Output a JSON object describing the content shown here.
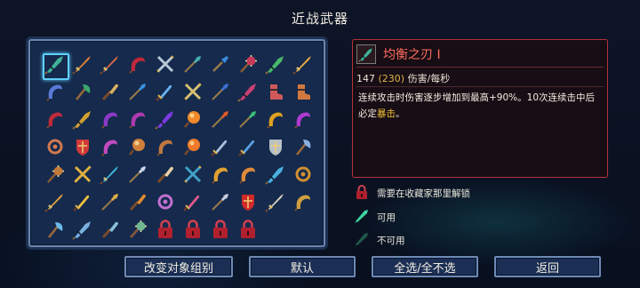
{
  "screen": {
    "title": "近战武器"
  },
  "grid": {
    "items": [
      {
        "icon": "balanced-blade-icon",
        "color": "#3fb49a",
        "shape": "blade",
        "selected": true
      },
      {
        "icon": "rusty-sword-icon",
        "color": "#e0843a",
        "shape": "sword"
      },
      {
        "icon": "broadsword-icon",
        "color": "#d86a4a",
        "shape": "sword"
      },
      {
        "icon": "whip-icon",
        "color": "#c0283a",
        "shape": "curve"
      },
      {
        "icon": "twin-daggers-icon",
        "color": "#b8c8d8",
        "shape": "cross"
      },
      {
        "icon": "spear-icon",
        "color": "#4ab0b0",
        "shape": "spear"
      },
      {
        "icon": "shovel-icon",
        "color": "#3a8ad8",
        "shape": "shovel"
      },
      {
        "icon": "spiked-club-icon",
        "color": "#c83a5a",
        "shape": "mace"
      },
      {
        "icon": "leaf-blade-icon",
        "color": "#4ab86a",
        "shape": "blade"
      },
      {
        "icon": "flame-sword-icon",
        "color": "#f0b040",
        "shape": "sword"
      },
      {
        "icon": "vine-whip-icon",
        "color": "#5a7ad8",
        "shape": "curve"
      },
      {
        "icon": "green-axe-icon",
        "color": "#3aa86a",
        "shape": "axe"
      },
      {
        "icon": "bone-club-icon",
        "color": "#d8b060",
        "shape": "club"
      },
      {
        "icon": "frost-spear-icon",
        "color": "#3a90e0",
        "shape": "spear"
      },
      {
        "icon": "ice-dagger-icon",
        "color": "#6ab0f0",
        "shape": "dagger"
      },
      {
        "icon": "crossed-blades-icon",
        "color": "#d8c070",
        "shape": "cross"
      },
      {
        "icon": "sapphire-rapier-icon",
        "color": "#3a70d0",
        "shape": "spear"
      },
      {
        "icon": "thorn-blade-icon",
        "color": "#c84070",
        "shape": "blade"
      },
      {
        "icon": "iron-boots-icon",
        "color": "#d05a5a",
        "shape": "boot"
      },
      {
        "icon": "war-boots-icon",
        "color": "#d07840",
        "shape": "boot"
      },
      {
        "icon": "blood-scythe-icon",
        "color": "#c02a3a",
        "shape": "curve"
      },
      {
        "icon": "golden-key-blade-icon",
        "color": "#d0a030",
        "shape": "blade"
      },
      {
        "icon": "violet-whip-icon",
        "color": "#8a3ac8",
        "shape": "curve"
      },
      {
        "icon": "serpent-whip-icon",
        "color": "#b03ab0",
        "shape": "curve"
      },
      {
        "icon": "shadow-blade-icon",
        "color": "#7a3ae0",
        "shape": "blade"
      },
      {
        "icon": "fire-fist-icon",
        "color": "#f08a2a",
        "shape": "orb"
      },
      {
        "icon": "pyro-staff-icon",
        "color": "#e05a2a",
        "shape": "spear"
      },
      {
        "icon": "jade-spear-icon",
        "color": "#3ac07a",
        "shape": "spear"
      },
      {
        "icon": "sun-scythe-icon",
        "color": "#e0a020",
        "shape": "curve"
      },
      {
        "icon": "curse-claw-icon",
        "color": "#b03ad0",
        "shape": "curve"
      },
      {
        "icon": "magnifier-club-icon",
        "color": "#d07850",
        "shape": "ring"
      },
      {
        "icon": "crimson-shield-icon",
        "color": "#d03a3a",
        "shape": "shield"
      },
      {
        "icon": "night-scythe-icon",
        "color": "#c04ac0",
        "shape": "curve"
      },
      {
        "icon": "lute-axe-icon",
        "color": "#d0803a",
        "shape": "orb"
      },
      {
        "icon": "hook-cane-icon",
        "color": "#c07840",
        "shape": "curve"
      },
      {
        "icon": "comet-blade-icon",
        "color": "#f07a2a",
        "shape": "orb"
      },
      {
        "icon": "steel-saber-icon",
        "color": "#a8c0d8",
        "shape": "dagger"
      },
      {
        "icon": "arc-dagger-icon",
        "color": "#5aa0e0",
        "shape": "dagger"
      },
      {
        "icon": "tome-flail-icon",
        "color": "#b8c0c8",
        "shape": "shield"
      },
      {
        "icon": "storm-axe-icon",
        "color": "#8ab0e0",
        "shape": "axe"
      },
      {
        "icon": "bronze-mace-icon",
        "color": "#c07a3a",
        "shape": "mace"
      },
      {
        "icon": "gold-crossguard-icon",
        "color": "#e0b040",
        "shape": "cross"
      },
      {
        "icon": "aqua-sword-icon",
        "color": "#40b8e0",
        "shape": "sword"
      },
      {
        "icon": "pearl-lance-icon",
        "color": "#d0d8e8",
        "shape": "spear"
      },
      {
        "icon": "bone-hammer-icon",
        "color": "#e8d0a8",
        "shape": "club"
      },
      {
        "icon": "cyan-trident-icon",
        "color": "#40a0c8",
        "shape": "cross"
      },
      {
        "icon": "golden-hook-icon",
        "color": "#e0a030",
        "shape": "curve"
      },
      {
        "icon": "ember-whip-icon",
        "color": "#e08a3a",
        "shape": "curve"
      },
      {
        "icon": "wave-scythe-icon",
        "color": "#4ab0e0",
        "shape": "blade"
      },
      {
        "icon": "spiked-ball-icon",
        "color": "#d09030",
        "shape": "ring"
      },
      {
        "icon": "amber-sword-icon",
        "color": "#e0a040",
        "shape": "sword"
      },
      {
        "icon": "torch-blade-icon",
        "color": "#f0c040",
        "shape": "dagger"
      },
      {
        "icon": "golden-scepter-icon",
        "color": "#e0b040",
        "shape": "spear"
      },
      {
        "icon": "war-club-icon",
        "color": "#e08a30",
        "shape": "club"
      },
      {
        "icon": "crystal-ring-icon",
        "color": "#c070d0",
        "shape": "ring"
      },
      {
        "icon": "rose-dagger-icon",
        "color": "#e05a8a",
        "shape": "dagger"
      },
      {
        "icon": "silver-rapier-icon",
        "color": "#c8d0e0",
        "shape": "spear"
      },
      {
        "icon": "royal-chest-blade-icon",
        "color": "#d02a2a",
        "shape": "shield"
      },
      {
        "icon": "bone-saber-icon",
        "color": "#d8d0c0",
        "shape": "sword"
      },
      {
        "icon": "chain-sickle-icon",
        "color": "#d0a040",
        "shape": "curve"
      },
      {
        "icon": "frost-axe-icon",
        "color": "#6ab8e8",
        "shape": "axe"
      },
      {
        "icon": "glacier-blade-icon",
        "color": "#7ab0e0",
        "shape": "blade"
      },
      {
        "icon": "spring-coil-icon",
        "color": "#8ac0d8",
        "shape": "club"
      },
      {
        "icon": "jade-hammer-icon",
        "color": "#70b890",
        "shape": "mace"
      },
      {
        "icon": "locked-blueprint-icon",
        "color": "#c0283a",
        "shape": "lock"
      },
      {
        "icon": "locked-blueprint-icon",
        "color": "#c0283a",
        "shape": "lock"
      },
      {
        "icon": "locked-blueprint-icon",
        "color": "#c0283a",
        "shape": "lock"
      },
      {
        "icon": "locked-blueprint-icon",
        "color": "#c0283a",
        "shape": "lock"
      }
    ]
  },
  "detail": {
    "icon": "balanced-blade-icon",
    "icon_color": "#3fb49a",
    "name": "均衡之刃 I",
    "dps": "147",
    "dps_alt": "(230)",
    "dps_label": "伤害/每秒",
    "desc_main": "连续攻击时伤害逐步增加到最高+90%。10次连续击中后必定",
    "desc_keyword": "暴击",
    "desc_end": "。"
  },
  "legend": {
    "locked_icon": "lock-icon",
    "locked_label": "需要在收藏家那里解锁",
    "available_icon": "available-blade-icon",
    "available_label": "可用",
    "unavailable_icon": "unavailable-blade-icon",
    "unavailable_label": "不可用"
  },
  "buttons": {
    "change_group": "改变对象组别",
    "default": "默认",
    "select_all": "全选/全不选",
    "back": "返回"
  },
  "colors": {
    "panel_bg": "#152a4c",
    "panel_border": "#6a86b0",
    "detail_border": "#b4323a",
    "item_name": "#ff6b5e",
    "keyword": "#f3c23a",
    "available": "#3fd0a0",
    "unavailable": "#1f5a4a",
    "lock": "#c0283a"
  }
}
